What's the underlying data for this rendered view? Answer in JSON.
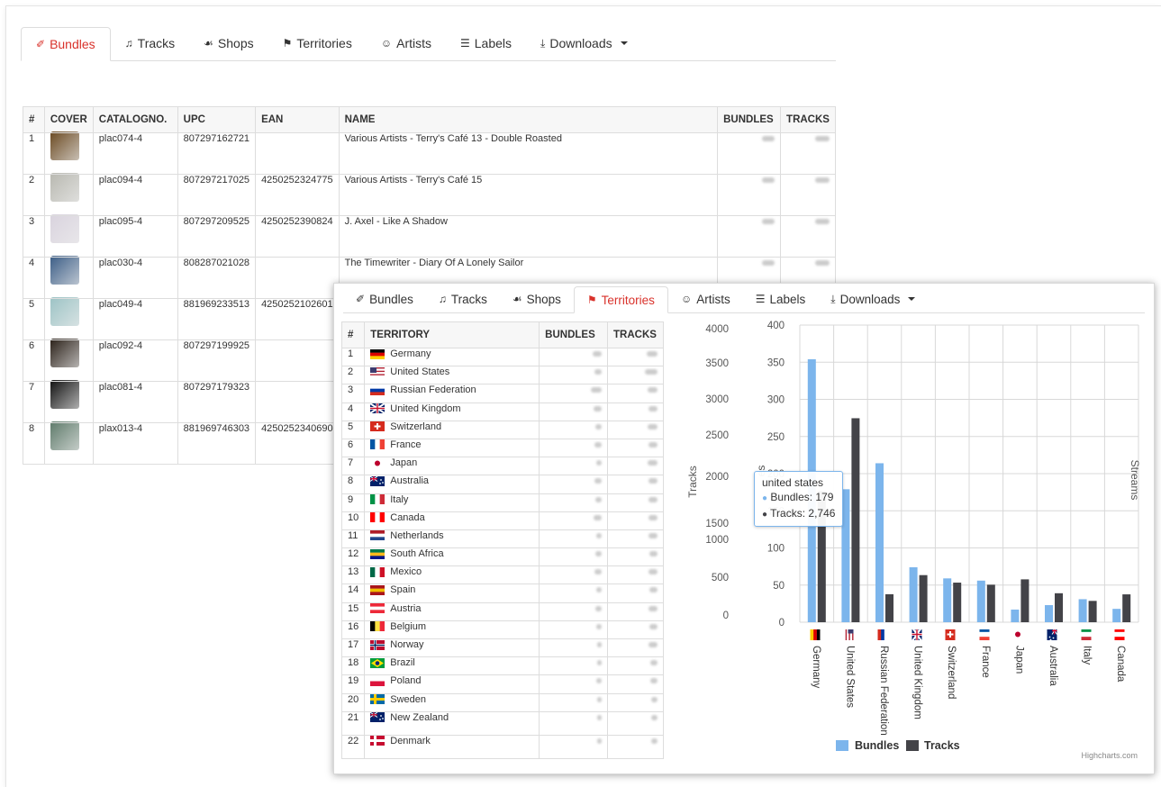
{
  "back": {
    "tabs": [
      {
        "label": "Bundles",
        "icon": "pushpin-icon",
        "active": true
      },
      {
        "label": "Tracks",
        "icon": "music-icon",
        "active": false
      },
      {
        "label": "Shops",
        "icon": "cart-icon",
        "active": false
      },
      {
        "label": "Territories",
        "icon": "flag-icon",
        "active": false
      },
      {
        "label": "Artists",
        "icon": "user-icon",
        "active": false
      },
      {
        "label": "Labels",
        "icon": "list-icon",
        "active": false
      },
      {
        "label": "Downloads",
        "icon": "download-icon",
        "active": false,
        "dropdown": true
      }
    ],
    "table": {
      "headers": [
        "#",
        "COVER",
        "CATALOGNO.",
        "UPC",
        "EAN",
        "NAME",
        "BUNDLES",
        "TRACKS"
      ],
      "rows": [
        {
          "n": "1",
          "catalog": "plac074-4",
          "upc": "807297162721",
          "ean": "",
          "name": "Various Artists - Terry's Café 13 - Double Roasted",
          "cover_color": "#6b4a22"
        },
        {
          "n": "2",
          "catalog": "plac094-4",
          "upc": "807297217025",
          "ean": "4250252324775",
          "name": "Various Artists - Terry's Café 15",
          "cover_color": "#b8b8b0"
        },
        {
          "n": "3",
          "catalog": "plac095-4",
          "upc": "807297209525",
          "ean": "4250252390824",
          "name": "J. Axel - Like A Shadow",
          "cover_color": "#d9d3de"
        },
        {
          "n": "4",
          "catalog": "plac030-4",
          "upc": "808287021028",
          "ean": "",
          "name": "The Timewriter - Diary Of A Lonely Sailor",
          "cover_color": "#3b5d86"
        },
        {
          "n": "5",
          "catalog": "plac049-4",
          "upc": "881969233513",
          "ean": "4250252102601",
          "name": "",
          "cover_color": "#9cc3c5"
        },
        {
          "n": "6",
          "catalog": "plac092-4",
          "upc": "807297199925",
          "ean": "",
          "name": "",
          "cover_color": "#2a2018"
        },
        {
          "n": "7",
          "catalog": "plac081-4",
          "upc": "807297179323",
          "ean": "",
          "name": "",
          "cover_color": "#111111"
        },
        {
          "n": "8",
          "catalog": "plax013-4",
          "upc": "881969746303",
          "ean": "4250252340690",
          "name": "",
          "cover_color": "#5e7a6a"
        }
      ]
    }
  },
  "front": {
    "tabs": [
      {
        "label": "Bundles",
        "icon": "pushpin-icon",
        "active": false
      },
      {
        "label": "Tracks",
        "icon": "music-icon",
        "active": false
      },
      {
        "label": "Shops",
        "icon": "cart-icon",
        "active": false
      },
      {
        "label": "Territories",
        "icon": "flag-icon",
        "active": true
      },
      {
        "label": "Artists",
        "icon": "user-icon",
        "active": false
      },
      {
        "label": "Labels",
        "icon": "list-icon",
        "active": false
      },
      {
        "label": "Downloads",
        "icon": "download-icon",
        "active": false,
        "dropdown": true
      }
    ],
    "table": {
      "headers": [
        "#",
        "TERRITORY",
        "BUNDLES",
        "TRACKS"
      ],
      "rows": [
        {
          "n": "1",
          "name": "Germany",
          "flag": [
            "#000000",
            "#dd0000",
            "#ffce00"
          ],
          "dir": "h"
        },
        {
          "n": "2",
          "name": "United States",
          "flag": [
            "#3c3b6e",
            "#ffffff",
            "#b22234"
          ],
          "dir": "us"
        },
        {
          "n": "3",
          "name": "Russian Federation",
          "flag": [
            "#ffffff",
            "#0039a6",
            "#d52b1e"
          ],
          "dir": "h"
        },
        {
          "n": "4",
          "name": "United Kingdom",
          "flag": [
            "#012169",
            "#ffffff",
            "#c8102e"
          ],
          "dir": "uk"
        },
        {
          "n": "5",
          "name": "Switzerland",
          "flag": [
            "#d52b1e",
            "#ffffff"
          ],
          "dir": "ch"
        },
        {
          "n": "6",
          "name": "France",
          "flag": [
            "#0055a4",
            "#ffffff",
            "#ef4135"
          ],
          "dir": "v"
        },
        {
          "n": "7",
          "name": "Japan",
          "flag": [
            "#ffffff",
            "#bc002d"
          ],
          "dir": "jp"
        },
        {
          "n": "8",
          "name": "Australia",
          "flag": [
            "#012169",
            "#ffffff",
            "#e4002b"
          ],
          "dir": "au"
        },
        {
          "n": "9",
          "name": "Italy",
          "flag": [
            "#009246",
            "#ffffff",
            "#ce2b37"
          ],
          "dir": "v"
        },
        {
          "n": "10",
          "name": "Canada",
          "flag": [
            "#ff0000",
            "#ffffff",
            "#ff0000"
          ],
          "dir": "v"
        },
        {
          "n": "11",
          "name": "Netherlands",
          "flag": [
            "#ae1c28",
            "#ffffff",
            "#21468b"
          ],
          "dir": "h"
        },
        {
          "n": "12",
          "name": "South Africa",
          "flag": [
            "#007749",
            "#ffb81c",
            "#001489"
          ],
          "dir": "h"
        },
        {
          "n": "13",
          "name": "Mexico",
          "flag": [
            "#006847",
            "#ffffff",
            "#ce1126"
          ],
          "dir": "v"
        },
        {
          "n": "14",
          "name": "Spain",
          "flag": [
            "#aa151b",
            "#f1bf00",
            "#aa151b"
          ],
          "dir": "h"
        },
        {
          "n": "15",
          "name": "Austria",
          "flag": [
            "#ed2939",
            "#ffffff",
            "#ed2939"
          ],
          "dir": "h"
        },
        {
          "n": "16",
          "name": "Belgium",
          "flag": [
            "#000000",
            "#fae042",
            "#ed2939"
          ],
          "dir": "v"
        },
        {
          "n": "17",
          "name": "Norway",
          "flag": [
            "#ba0c2f",
            "#ffffff",
            "#00205b"
          ],
          "dir": "nordic"
        },
        {
          "n": "18",
          "name": "Brazil",
          "flag": [
            "#009c3b",
            "#ffdf00",
            "#002776"
          ],
          "dir": "br"
        },
        {
          "n": "19",
          "name": "Poland",
          "flag": [
            "#ffffff",
            "#dc143c"
          ],
          "dir": "h"
        },
        {
          "n": "20",
          "name": "Sweden",
          "flag": [
            "#006aa7",
            "#fecc00",
            "#006aa7"
          ],
          "dir": "nordic"
        },
        {
          "n": "21",
          "name": "New Zealand",
          "flag": [
            "#012169",
            "#ffffff",
            "#c8102e"
          ],
          "dir": "au"
        },
        {
          "n": "22",
          "name": "Denmark",
          "flag": [
            "#c60c30",
            "#ffffff",
            "#c60c30"
          ],
          "dir": "nordic"
        }
      ]
    }
  },
  "chart_data": {
    "type": "bar",
    "categories": [
      "Germany",
      "United States",
      "Russian Federation",
      "United Kingdom",
      "Switzerland",
      "France",
      "Japan",
      "Australia",
      "Italy",
      "Canada"
    ],
    "series": [
      {
        "name": "Bundles",
        "color": "#7cb5ec",
        "values": [
          354,
          179,
          214,
          74,
          59,
          56,
          17,
          23,
          31,
          18
        ]
      },
      {
        "name": "Tracks",
        "color": "#434348",
        "values": [
          1767,
          2746,
          377,
          634,
          533,
          505,
          577,
          390,
          287,
          375
        ]
      }
    ],
    "left_axis": {
      "label": "Tracks",
      "ticks": [
        "4000",
        "3500",
        "3000",
        "2500",
        "2000",
        "1500",
        "1000",
        "500",
        "0"
      ],
      "range": [
        0,
        4000
      ]
    },
    "bundles_axis": {
      "label": "es",
      "ticks": [
        "400",
        "350",
        "300",
        "250",
        "200",
        "150",
        "100",
        "50",
        "0"
      ],
      "range": [
        0,
        400
      ]
    },
    "right_axis": {
      "label": "Streams"
    },
    "legend": [
      {
        "label": "Bundles",
        "color": "#7cb5ec"
      },
      {
        "label": "Tracks",
        "color": "#434348"
      }
    ],
    "legend_placement": "bottom",
    "tooltip": {
      "title": "united states",
      "line1": "Bundles: 179",
      "line2": "Tracks: 2,746"
    },
    "credits": "Highcharts.com",
    "grid": true
  }
}
